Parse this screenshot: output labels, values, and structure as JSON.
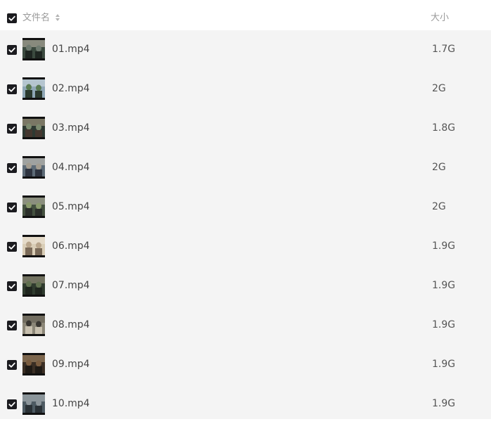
{
  "header": {
    "name_label": "文件名",
    "size_label": "大小",
    "sort_icon": "sort-up-down-icon",
    "select_all_checked": true
  },
  "colors": {
    "checkbox": "#1b1b1f",
    "list_background": "#f4f4f4",
    "header_text": "#9a9a9a"
  },
  "files": [
    {
      "name": "01.mp4",
      "size": "1.7G",
      "checked": true
    },
    {
      "name": "02.mp4",
      "size": "2G",
      "checked": true
    },
    {
      "name": "03.mp4",
      "size": "1.8G",
      "checked": true
    },
    {
      "name": "04.mp4",
      "size": "2G",
      "checked": true
    },
    {
      "name": "05.mp4",
      "size": "2G",
      "checked": true
    },
    {
      "name": "06.mp4",
      "size": "1.9G",
      "checked": true
    },
    {
      "name": "07.mp4",
      "size": "1.9G",
      "checked": true
    },
    {
      "name": "08.mp4",
      "size": "1.9G",
      "checked": true
    },
    {
      "name": "09.mp4",
      "size": "1.9G",
      "checked": true
    },
    {
      "name": "10.mp4",
      "size": "1.9G",
      "checked": true
    }
  ]
}
